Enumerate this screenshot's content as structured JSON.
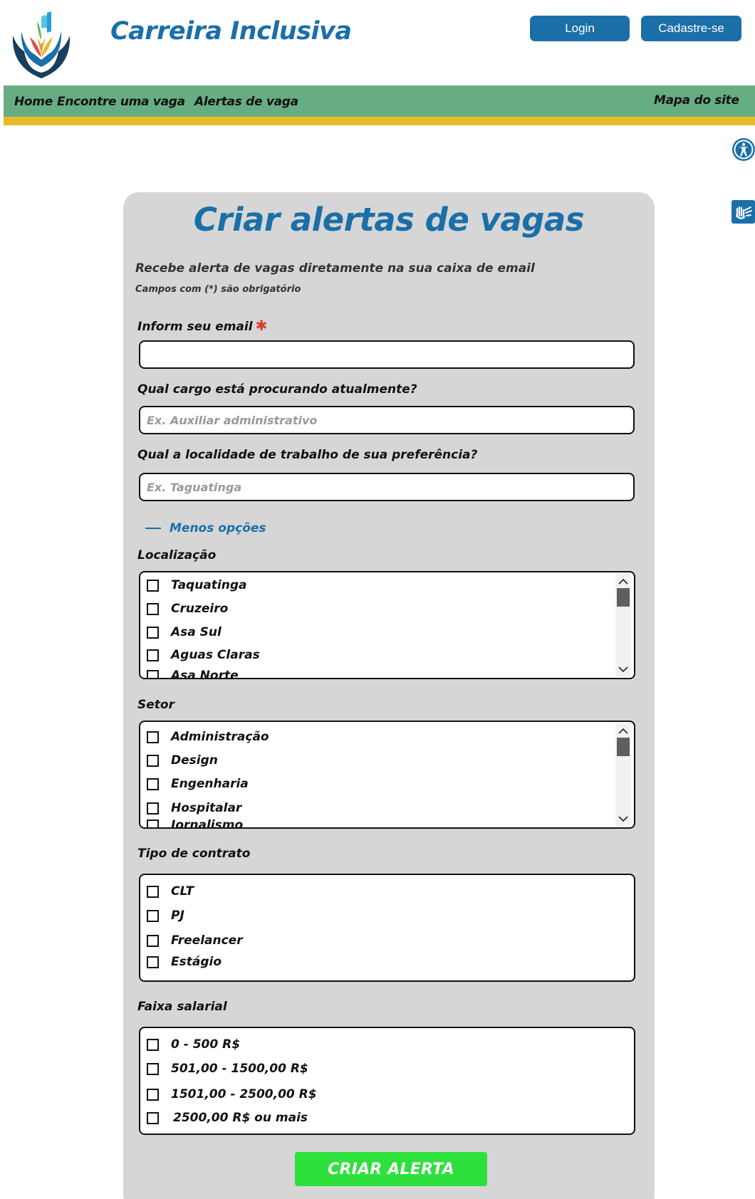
{
  "header": {
    "brand": "Carreira Inclusiva",
    "login_label": "Login",
    "signup_label": "Cadastre-se"
  },
  "nav": {
    "items": [
      "Home",
      "Encontre uma vaga",
      "Alertas de vaga"
    ],
    "sitemap": "Mapa do site"
  },
  "form": {
    "title": "Criar alertas de vagas",
    "subtitle": "Recebe alerta de vagas diretamente na sua caixa de email",
    "required_note": "Campos com (*) são obrigatório",
    "email": {
      "label": "Inform seu email",
      "required_mark": "✱",
      "value": "",
      "placeholder": ""
    },
    "cargo": {
      "label": "Qual cargo está procurando atualmente?",
      "value": "",
      "placeholder": "Ex. Auxiliar administrativo"
    },
    "localidade": {
      "label": "Qual a localidade de trabalho de sua preferência?",
      "value": "",
      "placeholder": "Ex. Taguatinga"
    },
    "less_options": "Menos opções",
    "localizacao": {
      "label": "Localização",
      "options": [
        "Taquatinga",
        "Cruzeiro",
        "Asa Sul",
        "Aguas Claras",
        "Asa Norte"
      ]
    },
    "setor": {
      "label": "Setor",
      "options": [
        "Administração",
        "Design",
        "Engenharia",
        "Hospitalar",
        "Jornalismo"
      ]
    },
    "contrato": {
      "label": "Tipo de contrato",
      "options": [
        "CLT",
        "PJ",
        "Freelancer",
        "Estágio"
      ]
    },
    "salario": {
      "label": "Faixa salarial",
      "options": [
        "0 - 500 R$",
        "501,00 - 1500,00 R$",
        "1501,00 - 2500,00 R$",
        "2500,00 R$ ou mais"
      ]
    },
    "submit_label": "CRIAR ALERTA"
  },
  "colors": {
    "brand_blue": "#1b6fa8",
    "nav_green": "#67ad83",
    "nav_stripe": "#e6bb25",
    "submit_green": "#2ee03c",
    "required_red": "#e03a2a"
  },
  "icons": [
    "site-logo-icon",
    "accessibility-icon",
    "sign-language-icon",
    "chevron-up-icon",
    "chevron-down-icon",
    "checkbox-icon"
  ]
}
